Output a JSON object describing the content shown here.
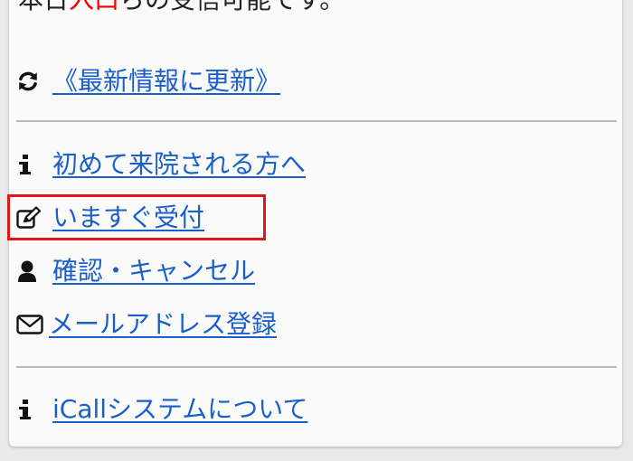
{
  "partial_top": {
    "before": "本日",
    "red": "入口",
    "after": "らの受信可能です。"
  },
  "links": [
    {
      "icon": "refresh-icon",
      "label": "《最新情報に更新》"
    },
    {
      "icon": "info-icon",
      "label": "初めて来院される方へ"
    },
    {
      "icon": "edit-icon",
      "label": "いますぐ受付"
    },
    {
      "icon": "user-icon",
      "label": "確認・キャンセル"
    },
    {
      "icon": "mail-icon",
      "label": "メールアドレス登録"
    },
    {
      "icon": "info-icon",
      "label": "iCallシステムについて"
    }
  ],
  "colors": {
    "link": "#1a5fc8",
    "highlight": "#e01818",
    "divider": "#b9b9b9"
  }
}
